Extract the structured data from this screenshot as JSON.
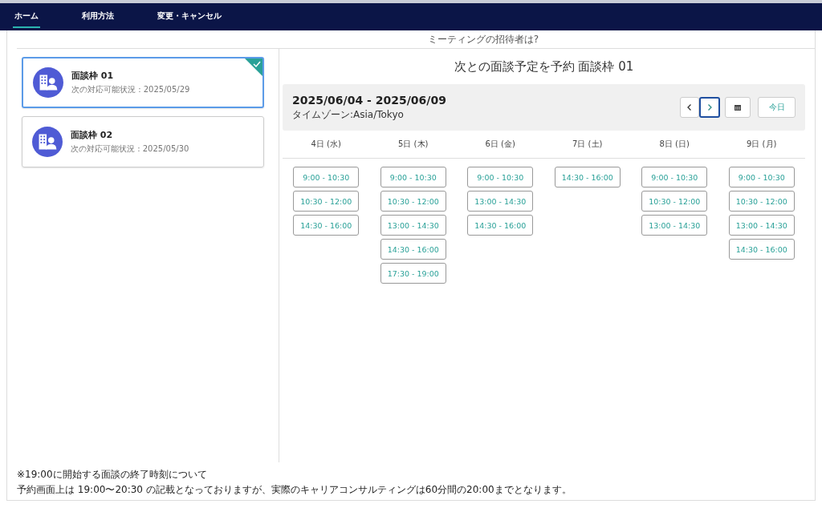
{
  "nav": [
    {
      "label": "ホーム",
      "selected": true
    },
    {
      "label": "利用方法",
      "selected": false
    },
    {
      "label": "変更・キャンセル",
      "selected": false
    }
  ],
  "heading": "ミーティングの招待者は?",
  "slots_list": [
    {
      "title": "面談枠 01",
      "availability": "次の対応可能状況 : 2025/05/29",
      "selected": true
    },
    {
      "title": "面談枠 02",
      "availability": "次の対応可能状況 : 2025/05/30",
      "selected": false
    }
  ],
  "schedule": {
    "title": "次との面談予定を予約 面談枠 01",
    "range": "2025/06/04 - 2025/06/09",
    "timezone": "タイムゾーン:Asia/Tokyo",
    "buttons": [
      {
        "kind": "prev",
        "focused": false
      },
      {
        "kind": "next",
        "focused": true
      },
      {
        "kind": "calendar",
        "focused": false
      },
      {
        "kind": "today",
        "label": "今日",
        "focused": false
      }
    ],
    "days": [
      {
        "label": "4日 (水)",
        "times": [
          "9:00 - 10:30",
          "10:30 - 12:00",
          "14:30 - 16:00"
        ]
      },
      {
        "label": "5日 (木)",
        "times": [
          "9:00 - 10:30",
          "10:30 - 12:00",
          "13:00 - 14:30",
          "14:30 - 16:00",
          "17:30 - 19:00"
        ]
      },
      {
        "label": "6日 (金)",
        "times": [
          "9:00 - 10:30",
          "13:00 - 14:30",
          "14:30 - 16:00"
        ]
      },
      {
        "label": "7日 (土)",
        "times": [
          "14:30 - 16:00"
        ]
      },
      {
        "label": "8日 (日)",
        "times": [
          "9:00 - 10:30",
          "10:30 - 12:00",
          "13:00 - 14:30"
        ]
      },
      {
        "label": "9日 (月)",
        "times": [
          "9:00 - 10:30",
          "10:30 - 12:00",
          "13:00 - 14:30",
          "14:30 - 16:00"
        ]
      }
    ]
  },
  "notes": [
    "※19:00に開始する面談の終了時刻について",
    "予約画面上は 19:00〜20:30 の記載となっておりますが、実際のキャリアコンサルティングは60分間の20:00までとなります。"
  ]
}
